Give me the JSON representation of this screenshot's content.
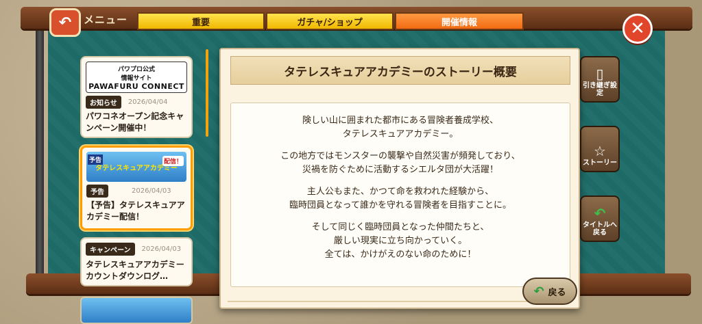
{
  "header": {
    "menu_label": "メニュー",
    "tabs": [
      {
        "label": "重要",
        "active": false
      },
      {
        "label": "ガチャ/ショップ",
        "active": false
      },
      {
        "label": "開催情報",
        "active": true
      }
    ],
    "close_icon": "close-icon",
    "back_icon": "back-arrow-icon"
  },
  "news_list": [
    {
      "banner_line1": "パワプロ公式",
      "banner_line2": "情報サイト",
      "banner_line3": "PAWAFURU CONNECT",
      "tag": "お知らせ",
      "date": "2026/04/04",
      "text": "パワコネオープン記念キャンペーン開催中！"
    },
    {
      "banner_badge": "予告",
      "banner_title": "タテレスキュアアカデミー",
      "banner_badge2": "配信！",
      "tag": "予告",
      "date": "2026/04/03",
      "text": "【予告】タテレスキュアアカデミー配信！",
      "selected": true
    },
    {
      "tag": "キャンペーン",
      "date": "2026/04/03",
      "text": "タテレスキュアアカデミーカウントダウンログ…"
    }
  ],
  "side_buttons": [
    {
      "label": "引き継ぎ設定",
      "icon": "phone-icon"
    },
    {
      "label": "ストーリー",
      "icon": "book-icon"
    },
    {
      "label": "タイトルへ戻る",
      "icon": "return-arrow-icon"
    }
  ],
  "modal": {
    "title": "タテレスキュアアカデミーのストーリー概要",
    "paragraphs": [
      [
        "険しい山に囲まれた都市にある冒険者養成学校、",
        "タテレスキュアアカデミー。"
      ],
      [
        "この地方ではモンスターの襲撃や自然災害が頻発しており、",
        "災禍を防ぐために活動するシエルタ団が大活躍！"
      ],
      [
        "主人公もまた、かつて命を救われた経験から、",
        "臨時団員となって誰かを守れる冒険者を目指すことに。"
      ],
      [
        "そして同じく臨時団員となった仲間たちと、",
        "厳しい現実に立ち向かっていく。",
        "全ては、かけがえのない命のために！"
      ]
    ]
  },
  "return_button": {
    "label": "戻る",
    "icon": "return-arrow-icon"
  },
  "colors": {
    "board": "#1f6e6a",
    "frame_wood": "#7a4321",
    "tab_yellow": "#f5c400",
    "tab_active": "#f26a12",
    "close_red": "#e2462a",
    "selected_border": "#ff9d00"
  }
}
